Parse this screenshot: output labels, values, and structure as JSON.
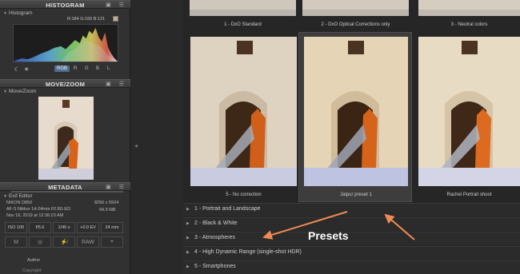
{
  "left_panel": {
    "histogram": {
      "section_title": "HISTOGRAM",
      "sub_title": "Histogram",
      "readout": "R:184 G:160 B:121",
      "swatch_color": "#c4ad8e",
      "channels": [
        "RGB",
        "R",
        "G",
        "B",
        "L"
      ],
      "selected_channel": "RGB",
      "icons": [
        "moon-icon",
        "sun-icon"
      ]
    },
    "movezoom": {
      "section_title": "MOVE/ZOOM",
      "sub_title": "Move/Zoom"
    },
    "metadata": {
      "section_title": "METADATA",
      "sub_title": "Exif Editor",
      "camera": "NIKON D850",
      "resolution": "8256 x 5504",
      "lens": "AF-S Nikkor 14-24mm f/2.8G ED",
      "file_size": "94.9 MB",
      "date": "Nov 16, 2019 at 12:36:23 AM",
      "exposure": [
        "ISO 100",
        "f/5.6",
        "1/40 s",
        "+0.0 EV",
        "24 mm"
      ],
      "badges": [
        "M",
        "RAW"
      ],
      "author_label": "Author",
      "copyright_label": "Copyright"
    }
  },
  "right_panel": {
    "top_captions": [
      "1 - DxO Standard",
      "2 - DxO Optical Corrections only",
      "3 - Neutral colors"
    ],
    "thumb_captions": [
      "5 - No correction",
      "Jaipur preset 1",
      "Rachel Portrait shoot"
    ],
    "selected_index": 1,
    "preset_groups": [
      "1 - Portrait and Landscape",
      "2 - Black & White",
      "3 - Atmospheres",
      "4 - High Dynamic Range (single-shot HDR)",
      "5 - Smartphones"
    ]
  },
  "annotation": {
    "label": "Presets",
    "arrow_color": "#f08a55"
  }
}
